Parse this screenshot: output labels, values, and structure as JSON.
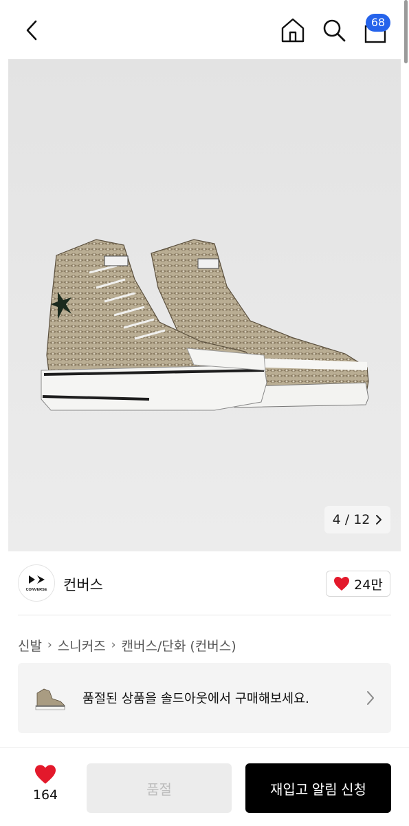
{
  "header": {
    "cart_count": "68",
    "icons": [
      "back-arrow-icon",
      "home-icon",
      "search-icon",
      "shopping-bag-icon"
    ]
  },
  "gallery": {
    "current": "4",
    "total": "12",
    "counter_text": "4 / 12"
  },
  "brand": {
    "name": "컨버스",
    "logo_text": "CONVERSE",
    "like_count": "24만"
  },
  "breadcrumb": {
    "items": [
      "신발",
      "스니커즈",
      "캔버스/단화 (컨버스)"
    ]
  },
  "banner": {
    "text": "품절된 상품을 솔드아웃에서 구매해보세요."
  },
  "bottom_bar": {
    "wish_count": "164",
    "soldout_label": "품절",
    "restock_label": "재입고 알림 신청"
  },
  "colors": {
    "accent_blue": "#2563eb",
    "heart_red": "#e3192b",
    "primary_black": "#000000"
  }
}
